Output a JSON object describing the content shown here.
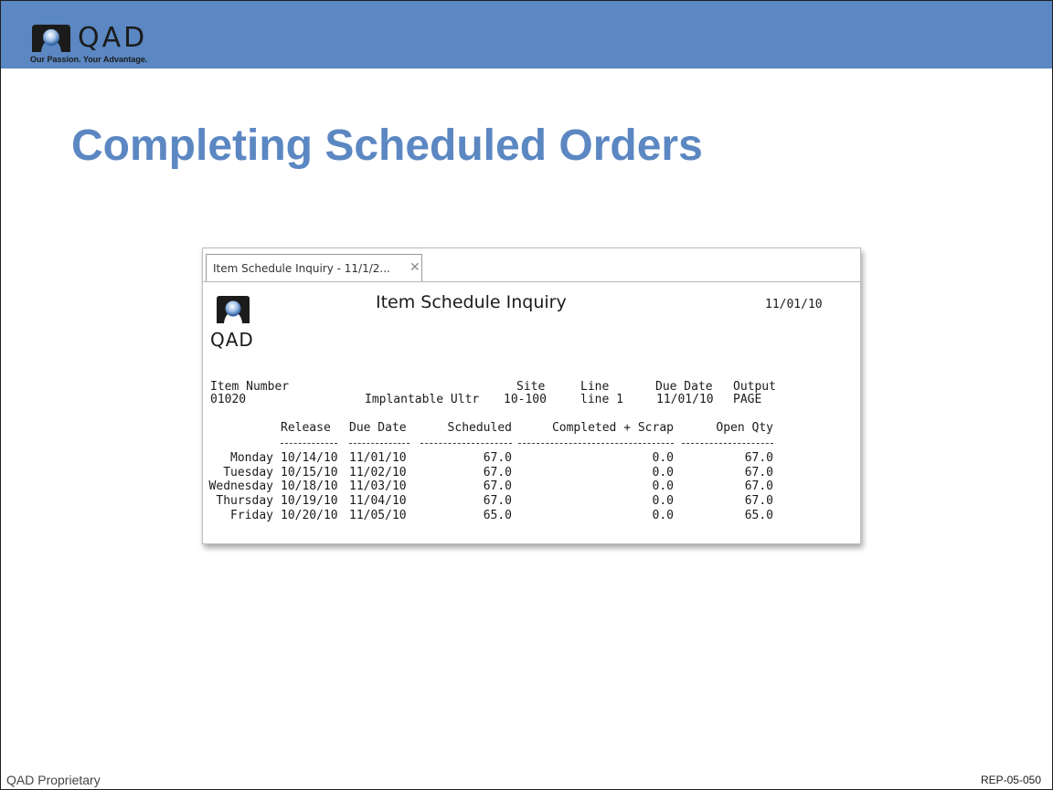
{
  "brand": {
    "name": "QAD",
    "tagline": "Our Passion. Your Advantage.",
    "color": "#5b87c2"
  },
  "slide": {
    "title": "Completing Scheduled Orders"
  },
  "window": {
    "tab_label": "Item Schedule Inquiry - 11/1/2...",
    "close_icon": "close-icon"
  },
  "report": {
    "logo_text": "QAD",
    "title": "Item Schedule Inquiry",
    "date": "11/01/10",
    "header": {
      "item_number_label": "Item Number",
      "item_number": "01020",
      "description": "Implantable Ultr",
      "site_label": "Site",
      "site": "10-100",
      "line_label": "Line",
      "line": "line 1",
      "due_date_label": "Due Date",
      "due_date": "11/01/10",
      "output_label": "Output",
      "output": "PAGE"
    },
    "columns": {
      "release": "Release",
      "due_date": "Due Date",
      "scheduled": "Scheduled",
      "completed_scrap": "Completed + Scrap",
      "open_qty": "Open Qty"
    },
    "rows": [
      {
        "day": "Monday",
        "release": "10/14/10",
        "due": "11/01/10",
        "scheduled": "67.0",
        "completed": "0.0",
        "open": "67.0"
      },
      {
        "day": "Tuesday",
        "release": "10/15/10",
        "due": "11/02/10",
        "scheduled": "67.0",
        "completed": "0.0",
        "open": "67.0"
      },
      {
        "day": "Wednesday",
        "release": "10/18/10",
        "due": "11/03/10",
        "scheduled": "67.0",
        "completed": "0.0",
        "open": "67.0"
      },
      {
        "day": "Thursday",
        "release": "10/19/10",
        "due": "11/04/10",
        "scheduled": "67.0",
        "completed": "0.0",
        "open": "67.0"
      },
      {
        "day": "Friday",
        "release": "10/20/10",
        "due": "11/05/10",
        "scheduled": "65.0",
        "completed": "0.0",
        "open": "65.0"
      }
    ]
  },
  "footer": {
    "left": "QAD Proprietary",
    "right": "REP-05-050"
  }
}
